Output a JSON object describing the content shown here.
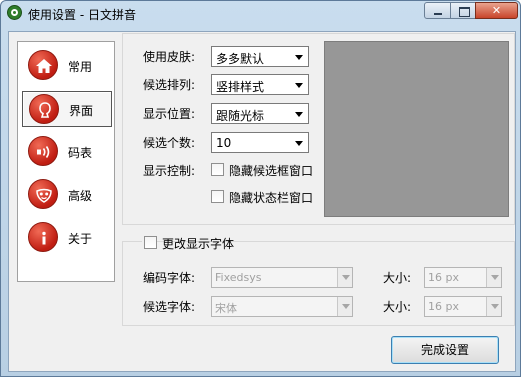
{
  "window": {
    "title": "使用设置 - 日文拼音"
  },
  "sidebar": {
    "items": [
      {
        "label": "常用",
        "icon": "home-icon",
        "selected": false
      },
      {
        "label": "界面",
        "icon": "face-icon",
        "selected": true
      },
      {
        "label": "码表",
        "icon": "sound-wave-icon",
        "selected": false
      },
      {
        "label": "高级",
        "icon": "mask-icon",
        "selected": false
      },
      {
        "label": "关于",
        "icon": "info-icon",
        "selected": false
      }
    ]
  },
  "settings": {
    "skin": {
      "label": "使用皮肤:",
      "value": "多多默认"
    },
    "order": {
      "label": "候选排列:",
      "value": "竖排样式"
    },
    "position": {
      "label": "显示位置:",
      "value": "跟随光标"
    },
    "count": {
      "label": "候选个数:",
      "value": "10"
    },
    "display": {
      "label": "显示控制:",
      "options": [
        {
          "label": "隐藏候选框窗口",
          "checked": false
        },
        {
          "label": "隐藏状态栏窗口",
          "checked": false
        }
      ]
    }
  },
  "font": {
    "toggle": {
      "label": "更改显示字体",
      "checked": false
    },
    "code_font": {
      "label": "编码字体:",
      "value": "Fixedsys",
      "size_label": "大小:",
      "size_value": "16 px"
    },
    "candidate_font": {
      "label": "候选字体:",
      "value": "宋体",
      "size_label": "大小:",
      "size_value": "16 px"
    }
  },
  "buttons": {
    "finish": "完成设置"
  },
  "colors": {
    "accent_red": "#c01d12",
    "preview_gray": "#979797",
    "titlebar": "#c9ddee"
  }
}
